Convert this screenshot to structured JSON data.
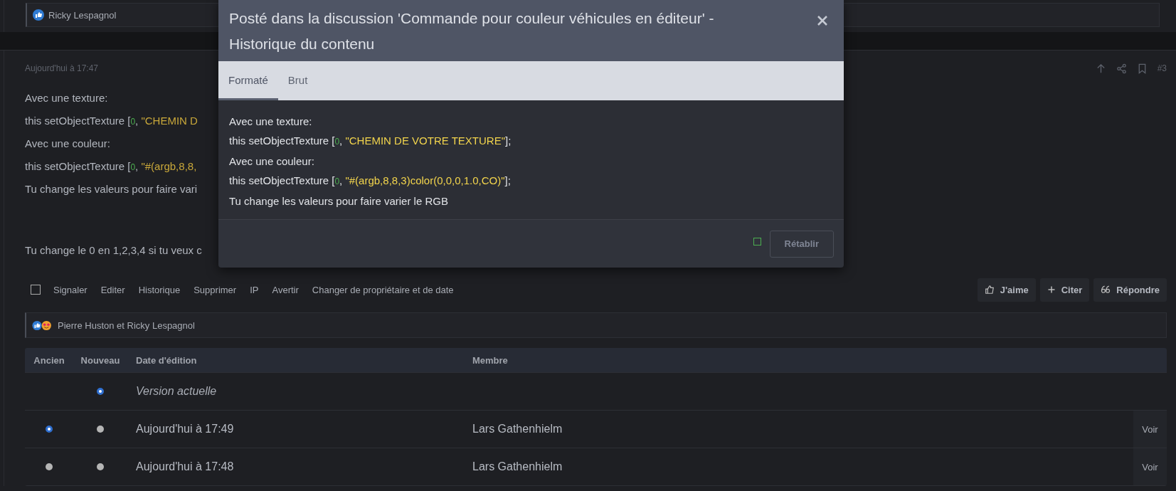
{
  "previous_post": {
    "reactions": "Ricky Lespagnol"
  },
  "post": {
    "date": "Aujourd'hui à 17:47",
    "number": "#3",
    "lines": [
      [
        {
          "kind": "plain",
          "text": "Avec une texture:"
        }
      ],
      [
        {
          "kind": "plain",
          "text": "this setObjectTexture ["
        },
        {
          "kind": "number",
          "text": "0"
        },
        {
          "kind": "plain",
          "text": ", "
        },
        {
          "kind": "string",
          "text": "\"CHEMIN D"
        }
      ],
      [
        {
          "kind": "plain",
          "text": "Avec une couleur:"
        }
      ],
      [
        {
          "kind": "plain",
          "text": "this setObjectTexture ["
        },
        {
          "kind": "number",
          "text": "0"
        },
        {
          "kind": "plain",
          "text": ", "
        },
        {
          "kind": "string",
          "text": "\"#(argb,8,8,"
        }
      ],
      [
        {
          "kind": "plain",
          "text": "Tu change les valeurs pour faire vari"
        }
      ],
      [
        {
          "kind": "gap"
        },
        {
          "kind": "plain",
          "text": "Tu change le 0 en 1,2,3,4 si tu veux c"
        }
      ]
    ],
    "select_checked": false,
    "actions": [
      "Signaler",
      "Editer",
      "Historique",
      "Supprimer",
      "IP",
      "Avertir",
      "Changer de propriétaire et de date"
    ],
    "buttons": [
      {
        "kind": "like",
        "label": "J'aime"
      },
      {
        "kind": "quote",
        "label": "Citer"
      },
      {
        "kind": "reply",
        "label": "Répondre"
      }
    ],
    "reactions": "Pierre Huston et Ricky Lespagnol"
  },
  "history": {
    "columns": [
      "Ancien",
      "Nouveau",
      "Date d'édition",
      "Membre"
    ],
    "rows": [
      {
        "old": null,
        "new": {
          "selected": true
        },
        "date": "Version actuelle",
        "current": true
      },
      {
        "old": {
          "selected": true
        },
        "new": {
          "selected": false
        },
        "date": "Aujourd'hui à 17:49",
        "member": "Lars Gathenhielm",
        "current": false,
        "action": "Voir"
      },
      {
        "old": {
          "selected": false
        },
        "new": {
          "selected": false
        },
        "date": "Aujourd'hui à 17:48",
        "member": "Lars Gathenhielm",
        "current": false,
        "action": "Voir"
      }
    ]
  },
  "modal": {
    "title": "Posté dans la discussion 'Commande pour couleur véhicules en éditeur' - Historique du contenu",
    "tabs": [
      {
        "label": "Formaté",
        "selected": true
      },
      {
        "label": "Brut",
        "selected": false
      }
    ],
    "lines": [
      [
        {
          "kind": "plain",
          "text": "Avec une texture:"
        }
      ],
      [
        {
          "kind": "plain",
          "text": "this setObjectTexture ["
        },
        {
          "kind": "number",
          "text": "0"
        },
        {
          "kind": "plain",
          "text": ", "
        },
        {
          "kind": "string",
          "text": "\"CHEMIN DE VOTRE TEXTURE\""
        },
        {
          "kind": "plain",
          "text": "];"
        }
      ],
      [
        {
          "kind": "plain",
          "text": "Avec une couleur:"
        }
      ],
      [
        {
          "kind": "plain",
          "text": "this setObjectTexture ["
        },
        {
          "kind": "number",
          "text": "0"
        },
        {
          "kind": "plain",
          "text": ", "
        },
        {
          "kind": "string",
          "text": "\"#(argb,8,8,3)color(0,0,0,1.0,CO)\""
        },
        {
          "kind": "plain",
          "text": "];"
        }
      ],
      [
        {
          "kind": "plain",
          "text": "Tu change les valeurs pour faire varier le RGB"
        }
      ]
    ],
    "restore_button": {
      "label": "Rétablir",
      "disabled": true
    }
  }
}
